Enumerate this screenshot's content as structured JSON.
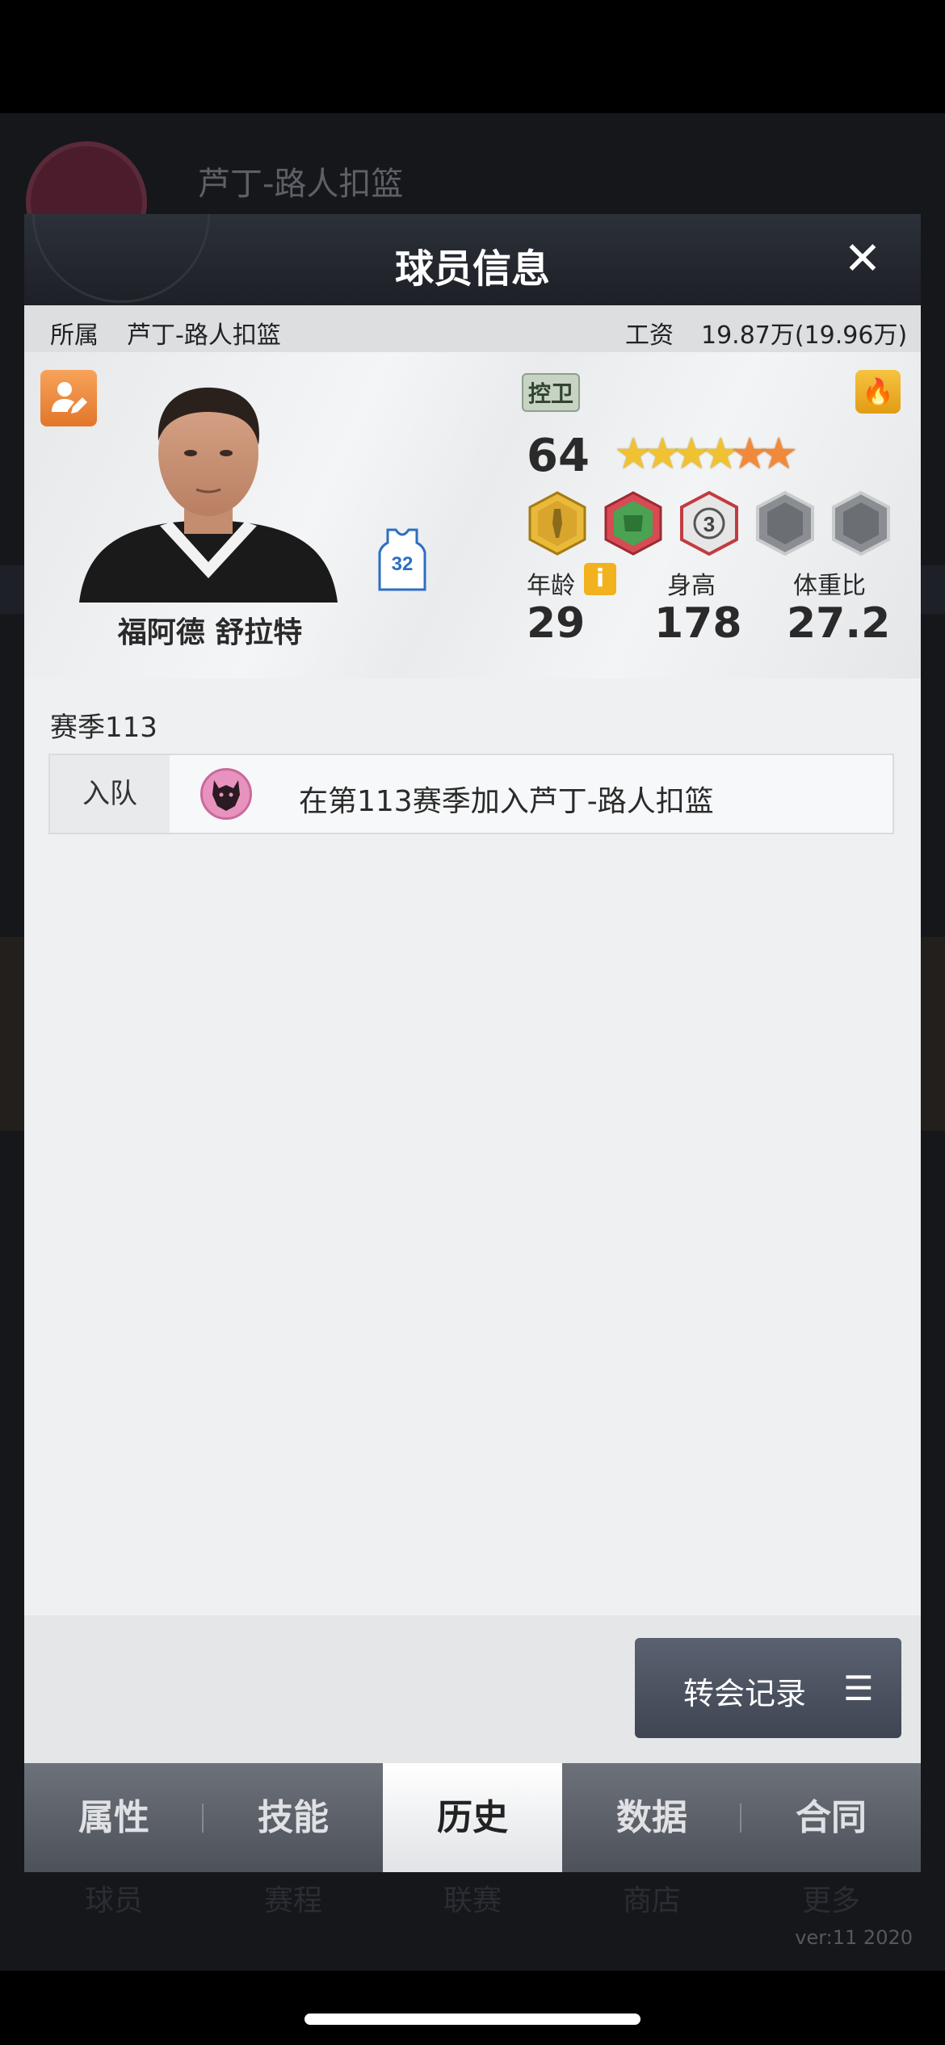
{
  "background": {
    "team_name": "芦丁-路人扣篮",
    "version": "ver:11  2020",
    "bottom_tabs": [
      "球员",
      "赛程",
      "联赛",
      "商店",
      "更多"
    ]
  },
  "modal": {
    "title": "球员信息",
    "close_symbol": "✕",
    "info_bar": {
      "team_label": "所属",
      "team_name": "芦丁-路人扣篮",
      "salary_label": "工资",
      "salary_value": "19.87万(19.96万)"
    },
    "player": {
      "name": "福阿德 舒拉特",
      "jersey_number": "32",
      "position": "控卫",
      "overall": "64",
      "stars_gold": 4,
      "stars_orange": 2,
      "badges": [
        "gold-hexagon-badge",
        "green-hexagon-badge",
        "three-point-badge",
        "locked-badge",
        "locked-badge"
      ],
      "age_label": "年龄",
      "age": "29",
      "height_label": "身高",
      "height": "178",
      "bmi_label": "体重比",
      "bmi": "27.2",
      "info_symbol": "i"
    },
    "history": {
      "season_title": "赛季113",
      "rows": [
        {
          "type": "入队",
          "text": "在第113赛季加入芦丁-路人扣篮"
        }
      ]
    },
    "transfer_button": {
      "label": "转会记录",
      "icon": "☰"
    },
    "tabs": [
      {
        "label": "属性",
        "active": false
      },
      {
        "label": "技能",
        "active": false
      },
      {
        "label": "历史",
        "active": true
      },
      {
        "label": "数据",
        "active": false
      },
      {
        "label": "合同",
        "active": false
      }
    ]
  },
  "colors": {
    "accent_orange": "#e2762a",
    "header_dark": "#1d2026",
    "tab_active": "#ffffff"
  }
}
